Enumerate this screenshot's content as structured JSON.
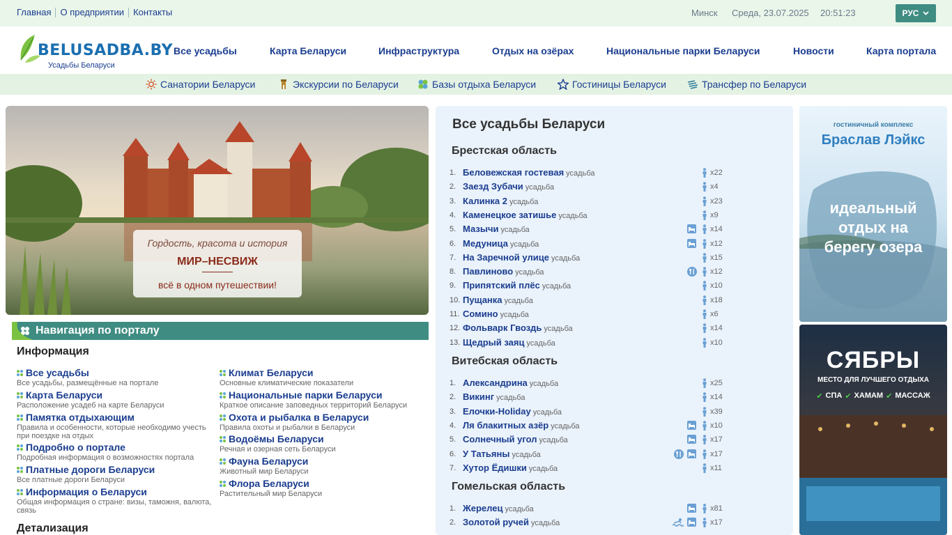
{
  "topbar": {
    "links": [
      "Главная",
      "О предприятии",
      "Контакты"
    ],
    "city": "Минск",
    "date": "Среда, 23.07.2025",
    "time": "20:51:23",
    "lang": "РУС"
  },
  "header": {
    "logo_text": "BELUSADBA.BY",
    "logo_sub": "Усадьбы Беларуси",
    "nav": [
      "Все усадьбы",
      "Карта Беларуси",
      "Инфраструктура",
      "Отдых на озёрах",
      "Национальные парки Беларуси",
      "Новости",
      "Карта портала"
    ]
  },
  "subnav": [
    {
      "label": "Санатории Беларуси",
      "icon": "sun-icon"
    },
    {
      "label": "Экскурсии по Беларуси",
      "icon": "tower-icon"
    },
    {
      "label": "Базы отдыха Беларуси",
      "icon": "flower-icon"
    },
    {
      "label": "Гостиницы Беларуси",
      "icon": "star-icon"
    },
    {
      "label": "Трансфер по Беларуси",
      "icon": "wind-icon"
    }
  ],
  "hero": {
    "line1": "Гордость, красота и история",
    "line2": "МИР–НЕСВИЖ",
    "line3": "всё в одном путешествии!"
  },
  "portal_nav": {
    "title": "Навигация по порталу",
    "section1": "Информация",
    "section2": "Детализация",
    "left": [
      {
        "title": "Все усадьбы",
        "desc": "Все усадьбы, размещённые на портале"
      },
      {
        "title": "Карта Беларуси",
        "desc": "Расположение усадеб на карте Беларуси"
      },
      {
        "title": "Памятка отдыхающим",
        "desc": "Правила и особенности, которые необходимо учесть при поездке на отдых"
      },
      {
        "title": "Подробно о портале",
        "desc": "Подробная информация о возможностях портала"
      },
      {
        "title": "Платные дороги Беларуси",
        "desc": "Все платные дороги Беларуси"
      },
      {
        "title": "Информация о Беларуси",
        "desc": "Общая информация о стране: визы, таможня, валюта, связь"
      }
    ],
    "right": [
      {
        "title": "Климат Беларуси",
        "desc": "Основные климатические показатели"
      },
      {
        "title": "Национальные парки Беларуси",
        "desc": "Краткое описание заповедных территорий Беларуси"
      },
      {
        "title": "Охота и рыбалка в Беларуси",
        "desc": "Правила охоты и рыбалки в Беларуси"
      },
      {
        "title": "Водоёмы Беларуси",
        "desc": "Речная и озерная сеть Беларуси"
      },
      {
        "title": "Фауна Беларуси",
        "desc": "Животный мир Беларуси"
      },
      {
        "title": "Флора Беларуси",
        "desc": "Растительный мир Беларуси"
      }
    ]
  },
  "estates": {
    "title": "Все усадьбы Беларуси",
    "type_label": "усадьба",
    "regions": [
      {
        "name": "Брестская область",
        "items": [
          {
            "n": "1.",
            "name": "Беловежская гостевая",
            "count": "x22",
            "icons": []
          },
          {
            "n": "2.",
            "name": "Заезд Зубачи",
            "count": "x4",
            "icons": []
          },
          {
            "n": "3.",
            "name": "Калинка 2",
            "count": "x23",
            "icons": []
          },
          {
            "n": "4.",
            "name": "Каменецкое затишье",
            "count": "x9",
            "icons": []
          },
          {
            "n": "5.",
            "name": "Мазычи",
            "count": "x14",
            "icons": [
              "bed"
            ]
          },
          {
            "n": "6.",
            "name": "Медуница",
            "count": "x12",
            "icons": [
              "bed"
            ]
          },
          {
            "n": "7.",
            "name": "На Заречной улице",
            "count": "x15",
            "icons": []
          },
          {
            "n": "8.",
            "name": "Павлиново",
            "count": "x12",
            "icons": [
              "food"
            ]
          },
          {
            "n": "9.",
            "name": "Припятский плёс",
            "count": "x10",
            "icons": []
          },
          {
            "n": "10.",
            "name": "Пущанка",
            "count": "x18",
            "icons": []
          },
          {
            "n": "11.",
            "name": "Сомино",
            "count": "x6",
            "icons": []
          },
          {
            "n": "12.",
            "name": "Фольварк Гвоздь",
            "count": "x14",
            "icons": []
          },
          {
            "n": "13.",
            "name": "Щедрый заяц",
            "count": "x10",
            "icons": []
          }
        ]
      },
      {
        "name": "Витебская область",
        "items": [
          {
            "n": "1.",
            "name": "Александрина",
            "count": "x25",
            "icons": []
          },
          {
            "n": "2.",
            "name": "Викинг",
            "count": "x14",
            "icons": []
          },
          {
            "n": "3.",
            "name": "Елочки-Holiday",
            "count": "x39",
            "icons": []
          },
          {
            "n": "4.",
            "name": "Ля блакитных азёр",
            "count": "x10",
            "icons": [
              "bed"
            ]
          },
          {
            "n": "5.",
            "name": "Солнечный угол",
            "count": "x17",
            "icons": [
              "bed"
            ]
          },
          {
            "n": "6.",
            "name": "У Татьяны",
            "count": "x17",
            "icons": [
              "food",
              "bed"
            ]
          },
          {
            "n": "7.",
            "name": "Хутор Ёдишки",
            "count": "x11",
            "icons": []
          }
        ]
      },
      {
        "name": "Гомельская область",
        "items": [
          {
            "n": "1.",
            "name": "Жерелец",
            "count": "x81",
            "icons": [
              "bed"
            ]
          },
          {
            "n": "2.",
            "name": "Золотой ручей",
            "count": "x17",
            "icons": [
              "pool",
              "bed"
            ]
          }
        ]
      }
    ]
  },
  "banners": {
    "b1_small": "гостиничный комплекс",
    "b1_title": "Браслав Лэйкс",
    "b1_l1": "идеальный",
    "b1_l2": "отдых на",
    "b1_l3": "берегу озера",
    "b2_title": "СЯБРЫ",
    "b2_sub": "МЕСТО ДЛЯ ЛУЧШЕГО ОТДЫХА",
    "b2_f1": "СПА",
    "b2_f2": "ХАМАМ",
    "b2_f3": "МАССАЖ"
  },
  "colors": {
    "link": "#1a3d8f",
    "accent": "#3f8c82",
    "topbar_bg": "#eaf6ea",
    "subnav_bg": "#e4f2e4",
    "panel_bg": "#eaf2fb"
  }
}
